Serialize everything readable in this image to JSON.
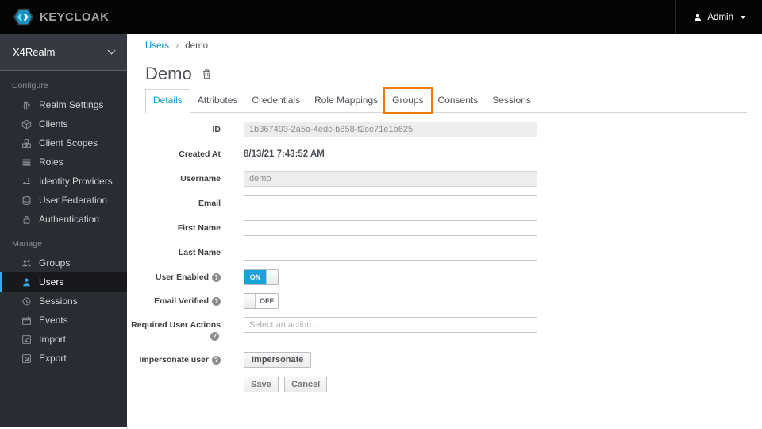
{
  "header": {
    "brand": "KEYCLOAK",
    "user_menu": {
      "label": "Admin"
    }
  },
  "sidebar": {
    "realm": "X4Realm",
    "sections": [
      {
        "label": "Configure",
        "items": [
          {
            "label": "Realm Settings",
            "icon": "sliders-icon"
          },
          {
            "label": "Clients",
            "icon": "cube-icon"
          },
          {
            "label": "Client Scopes",
            "icon": "cubes-icon"
          },
          {
            "label": "Roles",
            "icon": "list-icon"
          },
          {
            "label": "Identity Providers",
            "icon": "exchange-icon"
          },
          {
            "label": "User Federation",
            "icon": "database-icon"
          },
          {
            "label": "Authentication",
            "icon": "lock-icon"
          }
        ]
      },
      {
        "label": "Manage",
        "items": [
          {
            "label": "Groups",
            "icon": "users-group-icon"
          },
          {
            "label": "Users",
            "icon": "user-icon",
            "selected": true
          },
          {
            "label": "Sessions",
            "icon": "clock-icon"
          },
          {
            "label": "Events",
            "icon": "calendar-icon"
          },
          {
            "label": "Import",
            "icon": "import-icon"
          },
          {
            "label": "Export",
            "icon": "export-icon"
          }
        ]
      }
    ]
  },
  "breadcrumb": {
    "items": [
      "Users",
      "demo"
    ],
    "separator": "›"
  },
  "page": {
    "title": "Demo"
  },
  "tabs": [
    {
      "label": "Details",
      "active": true
    },
    {
      "label": "Attributes"
    },
    {
      "label": "Credentials"
    },
    {
      "label": "Role Mappings"
    },
    {
      "label": "Groups",
      "highlighted": true
    },
    {
      "label": "Consents"
    },
    {
      "label": "Sessions"
    }
  ],
  "form": {
    "fields": {
      "id": {
        "label": "ID",
        "value": "1b367493-2a5a-4edc-b858-f2ce71e1b625",
        "disabled": true
      },
      "created_at": {
        "label": "Created At",
        "value": "8/13/21 7:43:52 AM"
      },
      "username": {
        "label": "Username",
        "value": "demo",
        "disabled": true
      },
      "email": {
        "label": "Email",
        "value": ""
      },
      "first_name": {
        "label": "First Name",
        "value": ""
      },
      "last_name": {
        "label": "Last Name",
        "value": ""
      },
      "user_enabled": {
        "label": "User Enabled",
        "state": "ON"
      },
      "email_verified": {
        "label": "Email Verified",
        "state": "OFF"
      },
      "required_user_actions": {
        "label": "Required User Actions",
        "placeholder": "Select an action..."
      },
      "impersonate": {
        "label": "Impersonate user",
        "button": "Impersonate"
      }
    },
    "actions": {
      "save": "Save",
      "cancel": "Cancel"
    }
  },
  "icons": {
    "help": "?"
  },
  "colors": {
    "accent_blue": "#00a0dd",
    "link_blue": "#0088ce",
    "toggle_on_blue": "#16a3dc",
    "nav_selected_blue": "#2cb0e7",
    "annotation_orange": "#ec7a08"
  }
}
